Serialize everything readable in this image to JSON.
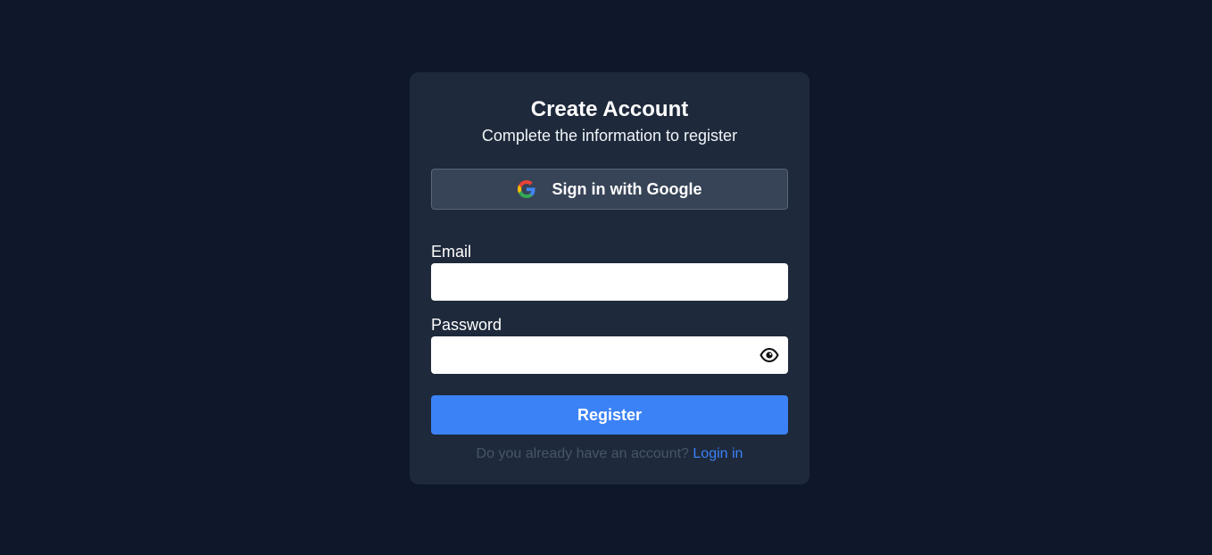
{
  "card": {
    "title": "Create Account",
    "subtitle": "Complete the information to register"
  },
  "google": {
    "label": "Sign in with Google",
    "icon": "google-logo-icon"
  },
  "form": {
    "email_label": "Email",
    "email_value": "",
    "password_label": "Password",
    "password_value": "",
    "password_toggle_icon": "eye-icon",
    "submit_label": "Register"
  },
  "footer": {
    "prompt": "Do you already have an account?",
    "link_label": "Login in"
  },
  "colors": {
    "background": "#0f172a",
    "card": "#1e293b",
    "google_button": "#374357",
    "accent": "#3b82f6",
    "muted_text": "#475569"
  }
}
